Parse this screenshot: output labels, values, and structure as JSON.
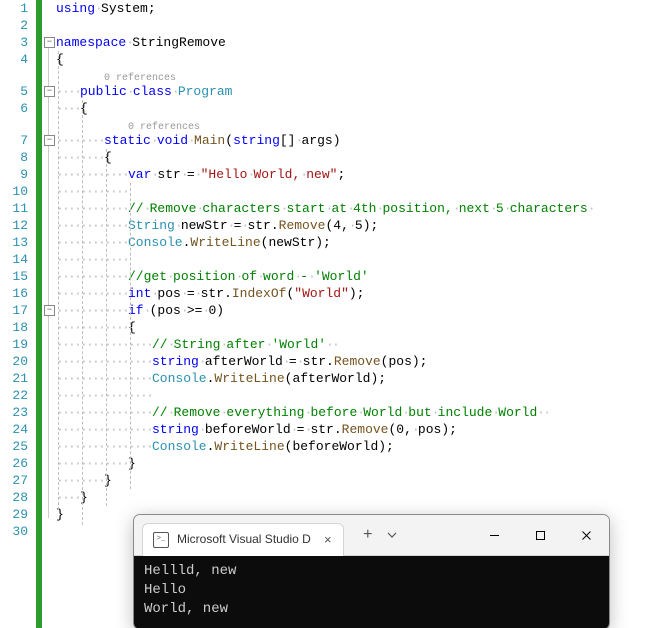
{
  "references_label": "0 references",
  "lines": [
    {
      "n": 1,
      "tokens": [
        {
          "t": "using ",
          "c": "kw"
        },
        {
          "t": "System"
        },
        {
          "t": ";"
        }
      ]
    },
    {
      "n": 2,
      "tokens": []
    },
    {
      "n": 3,
      "fold": true,
      "tokens": [
        {
          "t": "namespace ",
          "c": "kw"
        },
        {
          "t": "StringRemove"
        }
      ]
    },
    {
      "n": 4,
      "indent": 0,
      "tokens": [
        {
          "t": "{"
        }
      ]
    },
    {
      "ref": true,
      "indent": 1
    },
    {
      "n": 5,
      "fold": true,
      "indent": 1,
      "tokens": [
        {
          "t": "public ",
          "c": "kw"
        },
        {
          "t": "class ",
          "c": "kw"
        },
        {
          "t": "Program",
          "c": "cls"
        }
      ]
    },
    {
      "n": 6,
      "indent": 1,
      "tokens": [
        {
          "t": "{"
        }
      ]
    },
    {
      "ref": true,
      "indent": 2
    },
    {
      "n": 7,
      "fold": true,
      "indent": 2,
      "tokens": [
        {
          "t": "static ",
          "c": "kw"
        },
        {
          "t": "void ",
          "c": "kw"
        },
        {
          "t": "Main",
          "c": "mth"
        },
        {
          "t": "("
        },
        {
          "t": "string",
          "c": "kw"
        },
        {
          "t": "[] "
        },
        {
          "t": "args"
        },
        {
          "t": ")"
        }
      ]
    },
    {
      "n": 8,
      "indent": 2,
      "tokens": [
        {
          "t": "{"
        }
      ]
    },
    {
      "n": 9,
      "indent": 3,
      "tokens": [
        {
          "t": "var ",
          "c": "kw"
        },
        {
          "t": "str"
        },
        {
          "t": " = "
        },
        {
          "t": "\"Hello World, new\"",
          "c": "str"
        },
        {
          "t": ";"
        }
      ]
    },
    {
      "n": 10,
      "indent": 3,
      "tokens": []
    },
    {
      "n": 11,
      "indent": 3,
      "tokens": [
        {
          "t": "// Remove characters start at 4th position, next 5 characters ",
          "c": "com"
        }
      ]
    },
    {
      "n": 12,
      "indent": 3,
      "tokens": [
        {
          "t": "String",
          "c": "cls"
        },
        {
          "t": " newStr = str."
        },
        {
          "t": "Remove",
          "c": "mth"
        },
        {
          "t": "("
        },
        {
          "t": "4",
          "c": "num"
        },
        {
          "t": ", "
        },
        {
          "t": "5",
          "c": "num"
        },
        {
          "t": ");"
        }
      ]
    },
    {
      "n": 13,
      "indent": 3,
      "tokens": [
        {
          "t": "Console",
          "c": "cls"
        },
        {
          "t": "."
        },
        {
          "t": "WriteLine",
          "c": "mth"
        },
        {
          "t": "(newStr);"
        }
      ]
    },
    {
      "n": 14,
      "indent": 3,
      "tokens": []
    },
    {
      "n": 15,
      "indent": 3,
      "tokens": [
        {
          "t": "//get position of word - 'World'",
          "c": "com"
        }
      ]
    },
    {
      "n": 16,
      "indent": 3,
      "tokens": [
        {
          "t": "int ",
          "c": "kw"
        },
        {
          "t": "pos = str."
        },
        {
          "t": "IndexOf",
          "c": "mth"
        },
        {
          "t": "("
        },
        {
          "t": "\"World\"",
          "c": "str"
        },
        {
          "t": ");"
        }
      ]
    },
    {
      "n": 17,
      "fold": true,
      "indent": 3,
      "tokens": [
        {
          "t": "if ",
          "c": "kw"
        },
        {
          "t": "(pos >= "
        },
        {
          "t": "0",
          "c": "num"
        },
        {
          "t": ")"
        }
      ]
    },
    {
      "n": 18,
      "indent": 3,
      "tokens": [
        {
          "t": "{"
        }
      ]
    },
    {
      "n": 19,
      "indent": 4,
      "tokens": [
        {
          "t": "// String after 'World'  ",
          "c": "com"
        }
      ]
    },
    {
      "n": 20,
      "indent": 4,
      "tokens": [
        {
          "t": "string ",
          "c": "kw"
        },
        {
          "t": "afterWorld = str."
        },
        {
          "t": "Remove",
          "c": "mth"
        },
        {
          "t": "(pos);"
        }
      ]
    },
    {
      "n": 21,
      "indent": 4,
      "tokens": [
        {
          "t": "Console",
          "c": "cls"
        },
        {
          "t": "."
        },
        {
          "t": "WriteLine",
          "c": "mth"
        },
        {
          "t": "(afterWorld);"
        }
      ]
    },
    {
      "n": 22,
      "indent": 4,
      "tokens": []
    },
    {
      "n": 23,
      "indent": 4,
      "tokens": [
        {
          "t": "// Remove everything before World but include World  ",
          "c": "com"
        }
      ]
    },
    {
      "n": 24,
      "indent": 4,
      "tokens": [
        {
          "t": "string ",
          "c": "kw"
        },
        {
          "t": "beforeWorld = str."
        },
        {
          "t": "Remove",
          "c": "mth"
        },
        {
          "t": "("
        },
        {
          "t": "0",
          "c": "num"
        },
        {
          "t": ", pos);"
        }
      ]
    },
    {
      "n": 25,
      "indent": 4,
      "tokens": [
        {
          "t": "Console",
          "c": "cls"
        },
        {
          "t": "."
        },
        {
          "t": "WriteLine",
          "c": "mth"
        },
        {
          "t": "(beforeWorld);"
        }
      ]
    },
    {
      "n": 26,
      "indent": 3,
      "tokens": [
        {
          "t": "}"
        }
      ]
    },
    {
      "n": 27,
      "indent": 2,
      "tokens": [
        {
          "t": "}"
        }
      ]
    },
    {
      "n": 28,
      "indent": 1,
      "tokens": [
        {
          "t": "}"
        }
      ]
    },
    {
      "n": 29,
      "indent": 0,
      "tokens": [
        {
          "t": "}"
        }
      ]
    },
    {
      "n": 30,
      "tokens": []
    }
  ],
  "terminal": {
    "tab_title": "Microsoft Visual Studio D",
    "output": [
      "Hellld, new",
      "Hello",
      "World, new"
    ]
  }
}
